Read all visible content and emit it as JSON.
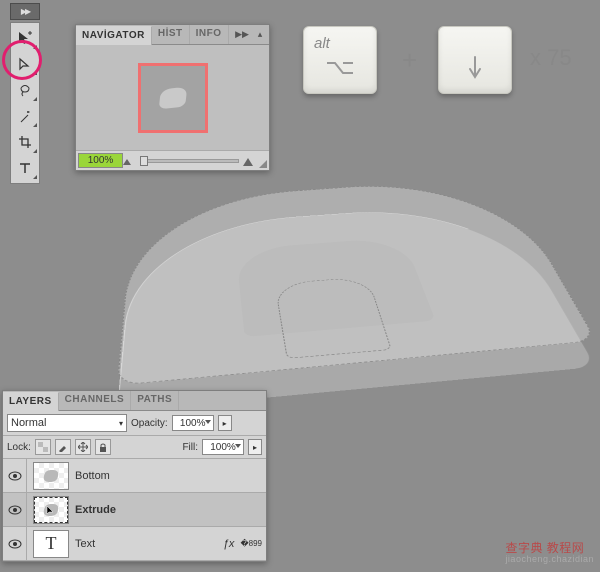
{
  "tl_chevron": "▶▶",
  "toolbox": {
    "tools": [
      "move",
      "path-select",
      "lasso",
      "wand",
      "crop",
      "type"
    ]
  },
  "navigator": {
    "tabs": [
      "NAVİGATOR",
      "HİST",
      "INFO"
    ],
    "menu_glyph": "▶▶",
    "close_glyph": "▴",
    "zoom": "100%",
    "zoom_out": "▵",
    "zoom_in": "▵"
  },
  "keys": {
    "alt_label": "alt",
    "plus": "+",
    "times_label": "x 75"
  },
  "layers": {
    "tabs": [
      "LAYERS",
      "CHANNELS",
      "PATHS"
    ],
    "blend_mode": "Normal",
    "opacity_label": "Opacity:",
    "opacity_value": "100%",
    "lock_label": "Lock:",
    "fill_label": "Fill:",
    "fill_value": "100%",
    "fx_glyph": "ƒx",
    "rows": [
      {
        "name": "Bottom",
        "selected": false,
        "thumb": "shape"
      },
      {
        "name": "Extrude",
        "selected": true,
        "thumb": "shape"
      },
      {
        "name": "Text",
        "selected": false,
        "thumb": "T"
      }
    ]
  },
  "watermark": {
    "main": "查字典 教程网",
    "sub": "jiaocheng.chazidian"
  }
}
